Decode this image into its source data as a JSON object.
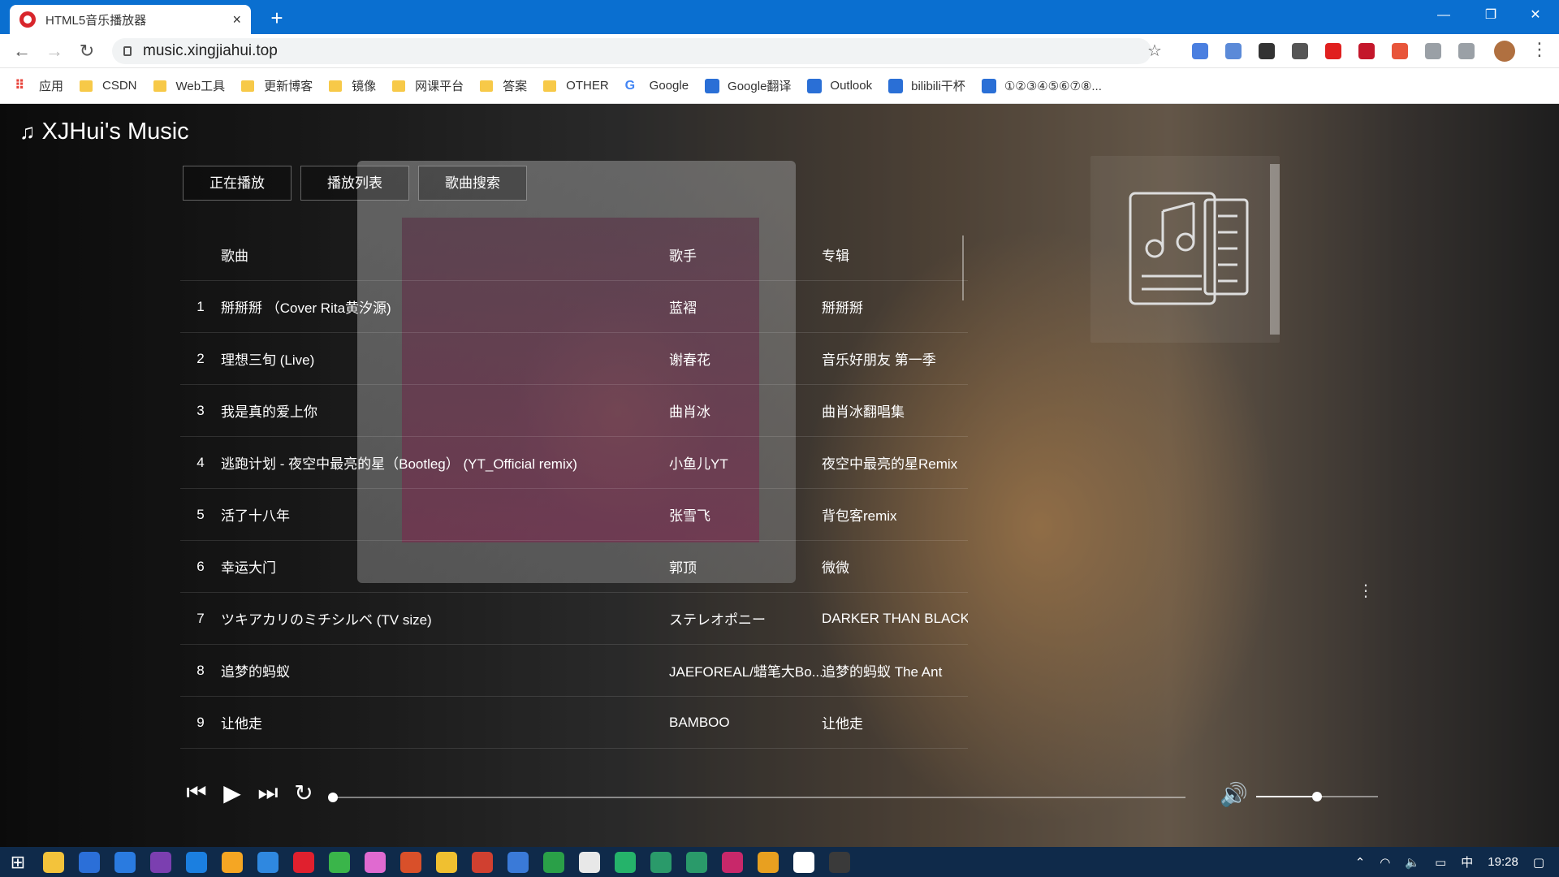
{
  "browser": {
    "tab_title": "HTML5音乐播放器",
    "tab_close": "×",
    "new_tab": "+",
    "url": "music.xingjiahui.top",
    "bookmarks": [
      {
        "label": "应用",
        "icon": "apps-grid-icon"
      },
      {
        "label": "CSDN",
        "icon": "folder-icon"
      },
      {
        "label": "Web工具",
        "icon": "folder-icon"
      },
      {
        "label": "更新博客",
        "icon": "folder-icon"
      },
      {
        "label": "镜像",
        "icon": "folder-icon"
      },
      {
        "label": "网课平台",
        "icon": "folder-icon"
      },
      {
        "label": "答案",
        "icon": "folder-icon"
      },
      {
        "label": "OTHER",
        "icon": "folder-icon"
      },
      {
        "label": "Google",
        "icon": "google-icon"
      },
      {
        "label": "Google翻译",
        "icon": "google-translate-icon"
      },
      {
        "label": "Outlook",
        "icon": "outlook-icon"
      },
      {
        "label": "bilibili干杯",
        "icon": "bilibili-icon"
      },
      {
        "label": "①②③④⑤⑥⑦⑧...",
        "icon": "site-icon"
      }
    ],
    "extension_colors": [
      "#4a7fe0",
      "#5b8ad8",
      "#333333",
      "#555555",
      "#e0201f",
      "#c4172b",
      "#e8553a",
      "#9aa0a6",
      "#9aa0a6"
    ]
  },
  "app": {
    "logo_icon": "music-note-icon",
    "logo_note": "♫",
    "title": "XJHui's Music",
    "tabs": [
      "正在播放",
      "播放列表",
      "歌曲搜索"
    ],
    "columns": {
      "song": "歌曲",
      "artist": "歌手",
      "album": "专辑"
    },
    "songs": [
      {
        "num": "1",
        "song": "掰掰掰 （Cover Rita黄汐源)",
        "artist": "蓝褶",
        "album": "掰掰掰"
      },
      {
        "num": "2",
        "song": "理想三旬 (Live)",
        "artist": "谢春花",
        "album": "音乐好朋友 第一季"
      },
      {
        "num": "3",
        "song": "我是真的爱上你",
        "artist": "曲肖冰",
        "album": "曲肖冰翻唱集"
      },
      {
        "num": "4",
        "song": "逃跑计划 - 夜空中最亮的星（Bootleg） (YT_Official remix)",
        "artist": "小鱼儿YT",
        "album": "夜空中最亮的星Remix"
      },
      {
        "num": "5",
        "song": "活了十八年",
        "artist": "张雪飞",
        "album": "背包客remix"
      },
      {
        "num": "6",
        "song": "幸运大门",
        "artist": "郭顶",
        "album": "微微"
      },
      {
        "num": "7",
        "song": "ツキアカリのミチシルベ (TV size)",
        "artist": "ステレオポニー",
        "album": "DARKER THAN BLACK..."
      },
      {
        "num": "8",
        "song": "追梦的蚂蚁",
        "artist": "JAEFOREAL/蜡笔大Bo...",
        "album": "追梦的蚂蚁 The Ant"
      },
      {
        "num": "9",
        "song": "让他走",
        "artist": "BAMBOO",
        "album": "让他走"
      }
    ],
    "progress": 0.0,
    "volume": 0.5
  },
  "taskbar": {
    "apps": [
      "#f3c33b",
      "#2b6fd8",
      "#2a7be0",
      "#7b3fb0",
      "#1b7fe0",
      "#f5a623",
      "#2f88e0",
      "#e0202e",
      "#3ab54a",
      "#e06ad0",
      "#d9502a",
      "#f0c030",
      "#d04030",
      "#3a7ad8",
      "#2aa048",
      "#e8e8e8",
      "#25b36a",
      "#2a9a6a",
      "#2a9a6a",
      "#c8286a",
      "#e8a020",
      "#ffffff",
      "#3a3a3a"
    ],
    "ime": "中",
    "time": "19:28"
  }
}
